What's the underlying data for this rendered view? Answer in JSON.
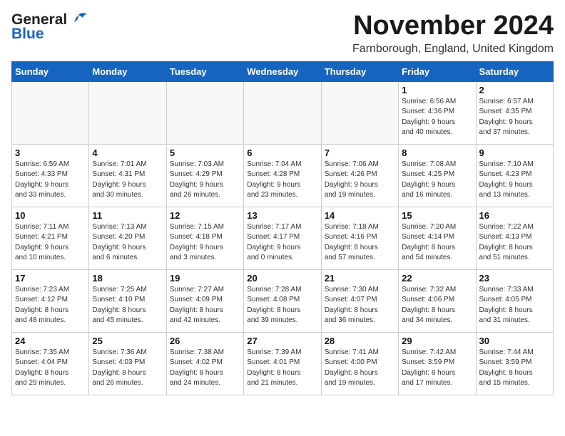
{
  "header": {
    "logo_line1": "General",
    "logo_line2": "Blue",
    "month": "November 2024",
    "location": "Farnborough, England, United Kingdom"
  },
  "weekdays": [
    "Sunday",
    "Monday",
    "Tuesday",
    "Wednesday",
    "Thursday",
    "Friday",
    "Saturday"
  ],
  "weeks": [
    [
      {
        "day": "",
        "detail": ""
      },
      {
        "day": "",
        "detail": ""
      },
      {
        "day": "",
        "detail": ""
      },
      {
        "day": "",
        "detail": ""
      },
      {
        "day": "",
        "detail": ""
      },
      {
        "day": "1",
        "detail": "Sunrise: 6:56 AM\nSunset: 4:36 PM\nDaylight: 9 hours\nand 40 minutes."
      },
      {
        "day": "2",
        "detail": "Sunrise: 6:57 AM\nSunset: 4:35 PM\nDaylight: 9 hours\nand 37 minutes."
      }
    ],
    [
      {
        "day": "3",
        "detail": "Sunrise: 6:59 AM\nSunset: 4:33 PM\nDaylight: 9 hours\nand 33 minutes."
      },
      {
        "day": "4",
        "detail": "Sunrise: 7:01 AM\nSunset: 4:31 PM\nDaylight: 9 hours\nand 30 minutes."
      },
      {
        "day": "5",
        "detail": "Sunrise: 7:03 AM\nSunset: 4:29 PM\nDaylight: 9 hours\nand 26 minutes."
      },
      {
        "day": "6",
        "detail": "Sunrise: 7:04 AM\nSunset: 4:28 PM\nDaylight: 9 hours\nand 23 minutes."
      },
      {
        "day": "7",
        "detail": "Sunrise: 7:06 AM\nSunset: 4:26 PM\nDaylight: 9 hours\nand 19 minutes."
      },
      {
        "day": "8",
        "detail": "Sunrise: 7:08 AM\nSunset: 4:25 PM\nDaylight: 9 hours\nand 16 minutes."
      },
      {
        "day": "9",
        "detail": "Sunrise: 7:10 AM\nSunset: 4:23 PM\nDaylight: 9 hours\nand 13 minutes."
      }
    ],
    [
      {
        "day": "10",
        "detail": "Sunrise: 7:11 AM\nSunset: 4:21 PM\nDaylight: 9 hours\nand 10 minutes."
      },
      {
        "day": "11",
        "detail": "Sunrise: 7:13 AM\nSunset: 4:20 PM\nDaylight: 9 hours\nand 6 minutes."
      },
      {
        "day": "12",
        "detail": "Sunrise: 7:15 AM\nSunset: 4:18 PM\nDaylight: 9 hours\nand 3 minutes."
      },
      {
        "day": "13",
        "detail": "Sunrise: 7:17 AM\nSunset: 4:17 PM\nDaylight: 9 hours\nand 0 minutes."
      },
      {
        "day": "14",
        "detail": "Sunrise: 7:18 AM\nSunset: 4:16 PM\nDaylight: 8 hours\nand 57 minutes."
      },
      {
        "day": "15",
        "detail": "Sunrise: 7:20 AM\nSunset: 4:14 PM\nDaylight: 8 hours\nand 54 minutes."
      },
      {
        "day": "16",
        "detail": "Sunrise: 7:22 AM\nSunset: 4:13 PM\nDaylight: 8 hours\nand 51 minutes."
      }
    ],
    [
      {
        "day": "17",
        "detail": "Sunrise: 7:23 AM\nSunset: 4:12 PM\nDaylight: 8 hours\nand 48 minutes."
      },
      {
        "day": "18",
        "detail": "Sunrise: 7:25 AM\nSunset: 4:10 PM\nDaylight: 8 hours\nand 45 minutes."
      },
      {
        "day": "19",
        "detail": "Sunrise: 7:27 AM\nSunset: 4:09 PM\nDaylight: 8 hours\nand 42 minutes."
      },
      {
        "day": "20",
        "detail": "Sunrise: 7:28 AM\nSunset: 4:08 PM\nDaylight: 8 hours\nand 39 minutes."
      },
      {
        "day": "21",
        "detail": "Sunrise: 7:30 AM\nSunset: 4:07 PM\nDaylight: 8 hours\nand 36 minutes."
      },
      {
        "day": "22",
        "detail": "Sunrise: 7:32 AM\nSunset: 4:06 PM\nDaylight: 8 hours\nand 34 minutes."
      },
      {
        "day": "23",
        "detail": "Sunrise: 7:33 AM\nSunset: 4:05 PM\nDaylight: 8 hours\nand 31 minutes."
      }
    ],
    [
      {
        "day": "24",
        "detail": "Sunrise: 7:35 AM\nSunset: 4:04 PM\nDaylight: 8 hours\nand 29 minutes."
      },
      {
        "day": "25",
        "detail": "Sunrise: 7:36 AM\nSunset: 4:03 PM\nDaylight: 8 hours\nand 26 minutes."
      },
      {
        "day": "26",
        "detail": "Sunrise: 7:38 AM\nSunset: 4:02 PM\nDaylight: 8 hours\nand 24 minutes."
      },
      {
        "day": "27",
        "detail": "Sunrise: 7:39 AM\nSunset: 4:01 PM\nDaylight: 8 hours\nand 21 minutes."
      },
      {
        "day": "28",
        "detail": "Sunrise: 7:41 AM\nSunset: 4:00 PM\nDaylight: 8 hours\nand 19 minutes."
      },
      {
        "day": "29",
        "detail": "Sunrise: 7:42 AM\nSunset: 3:59 PM\nDaylight: 8 hours\nand 17 minutes."
      },
      {
        "day": "30",
        "detail": "Sunrise: 7:44 AM\nSunset: 3:59 PM\nDaylight: 8 hours\nand 15 minutes."
      }
    ]
  ]
}
